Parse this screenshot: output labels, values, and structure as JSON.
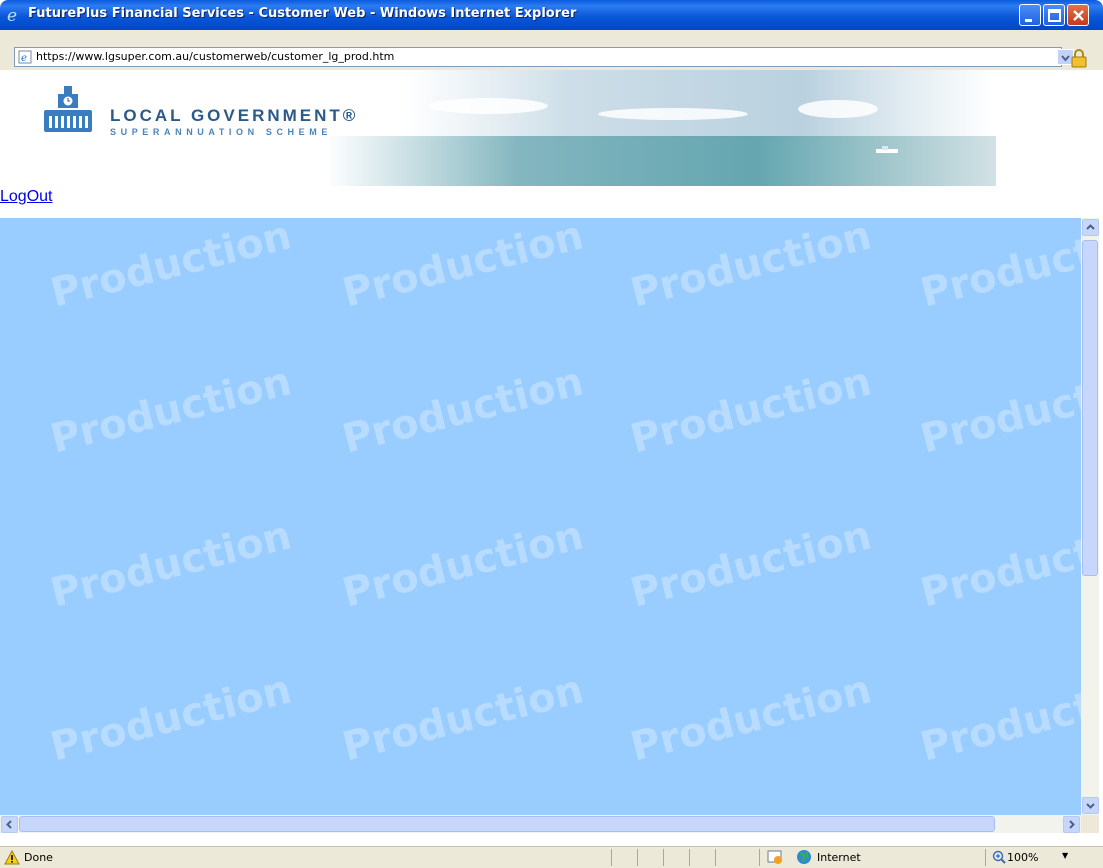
{
  "window": {
    "title": "FuturePlus Financial Services - Customer Web - Windows Internet Explorer",
    "icons": [
      "ie-icon",
      "minimize-icon",
      "maximize-icon",
      "close-icon"
    ]
  },
  "address_bar": {
    "url": "https://www.lgsuper.com.au/customerweb/customer_lg_prod.htm",
    "icons": [
      "page-icon",
      "chevron-down-icon",
      "lock-icon"
    ]
  },
  "banner": {
    "brand_line1": "LOCAL GOVERNMENT®",
    "brand_line2": "SUPERANNUATION SCHEME"
  },
  "nav": {
    "logout_label": "LogOut"
  },
  "frame": {
    "watermark": "Production",
    "background": "#99ccff"
  },
  "status_bar": {
    "status": "Done",
    "zone": "Internet",
    "zoom": "100%"
  }
}
